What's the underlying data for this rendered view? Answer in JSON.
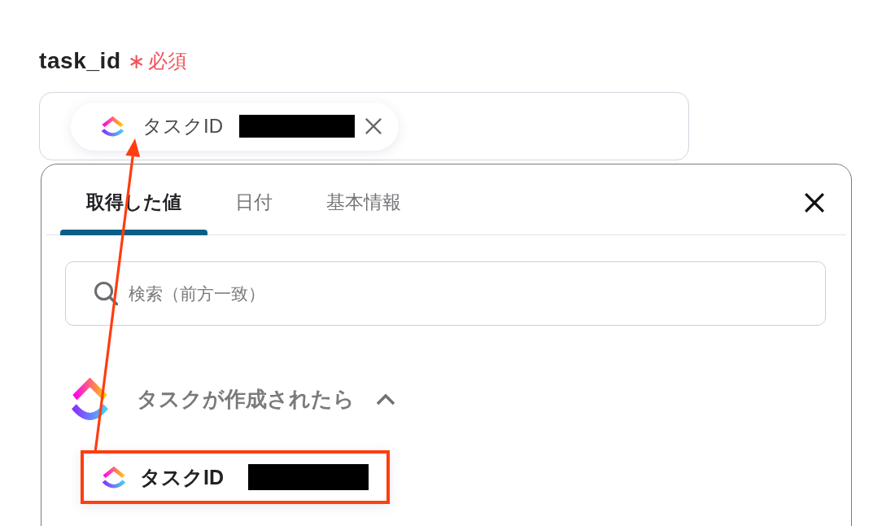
{
  "field": {
    "label": "task_id",
    "required_mark": "∗",
    "required_text": "必須",
    "chips": [
      {
        "label": "タスクID",
        "redacted": true
      }
    ]
  },
  "panel": {
    "tabs": [
      {
        "label": "取得した値",
        "selected": true
      },
      {
        "label": "日付",
        "selected": false
      },
      {
        "label": "基本情報",
        "selected": false
      }
    ],
    "search": {
      "placeholder": "検索（前方一致）"
    },
    "groups": [
      {
        "title": "タスクが作成されたら",
        "expanded": true,
        "items": [
          {
            "label": "タスクID",
            "redacted": true,
            "highlighted": true
          }
        ]
      }
    ]
  },
  "annotation": {
    "arrow": true
  }
}
